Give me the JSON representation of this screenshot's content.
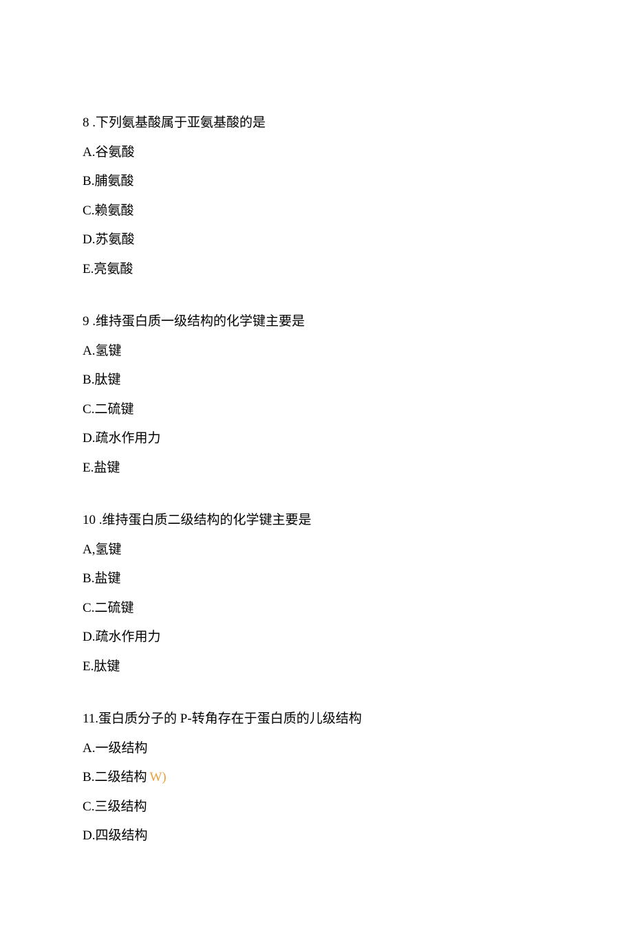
{
  "questions": [
    {
      "number": "8",
      "num_sep": " .",
      "stem": "下列氨基酸属于亚氨基酸的是",
      "options": [
        {
          "label": "A",
          "sep": ".",
          "text": "谷氨酸"
        },
        {
          "label": "B",
          "sep": ".",
          "text": "脯氨酸"
        },
        {
          "label": "C",
          "sep": ".",
          "text": "赖氨酸"
        },
        {
          "label": "D",
          "sep": ".",
          "text": "苏氨酸"
        },
        {
          "label": "E",
          "sep": ".",
          "text": "亮氨酸"
        }
      ]
    },
    {
      "number": "9",
      "num_sep": " .",
      "stem": "维持蛋白质一级结构的化学键主要是",
      "options": [
        {
          "label": "A",
          "sep": ".",
          "text": "氢键"
        },
        {
          "label": "B",
          "sep": ".",
          "text": "肽键"
        },
        {
          "label": "C",
          "sep": ".",
          "text": "二硫键"
        },
        {
          "label": "D",
          "sep": ".",
          "text": "疏水作用力"
        },
        {
          "label": "E",
          "sep": ".",
          "text": "盐键"
        }
      ]
    },
    {
      "number": "10",
      "num_sep": " .",
      "stem": "维持蛋白质二级结构的化学键主要是",
      "options": [
        {
          "label": "A",
          "sep": ",",
          "text": "氢键"
        },
        {
          "label": "B",
          "sep": ".",
          "text": "盐键"
        },
        {
          "label": "C",
          "sep": ".",
          "text": "二硫键"
        },
        {
          "label": "D",
          "sep": ".",
          "text": "疏水作用力"
        },
        {
          "label": "E",
          "sep": ".",
          "text": "肽键"
        }
      ]
    },
    {
      "number": "11",
      "num_sep": ".",
      "stem": "蛋白质分子的 P-转角存在于蛋白质的儿级结构",
      "options": [
        {
          "label": "A",
          "sep": ".",
          "text": "一级结构"
        },
        {
          "label": "B",
          "sep": ".",
          "text": "二级结构",
          "annotation": "W)"
        },
        {
          "label": "C",
          "sep": ".",
          "text": "三级结构"
        },
        {
          "label": "D",
          "sep": ".",
          "text": "四级结构"
        }
      ]
    }
  ]
}
